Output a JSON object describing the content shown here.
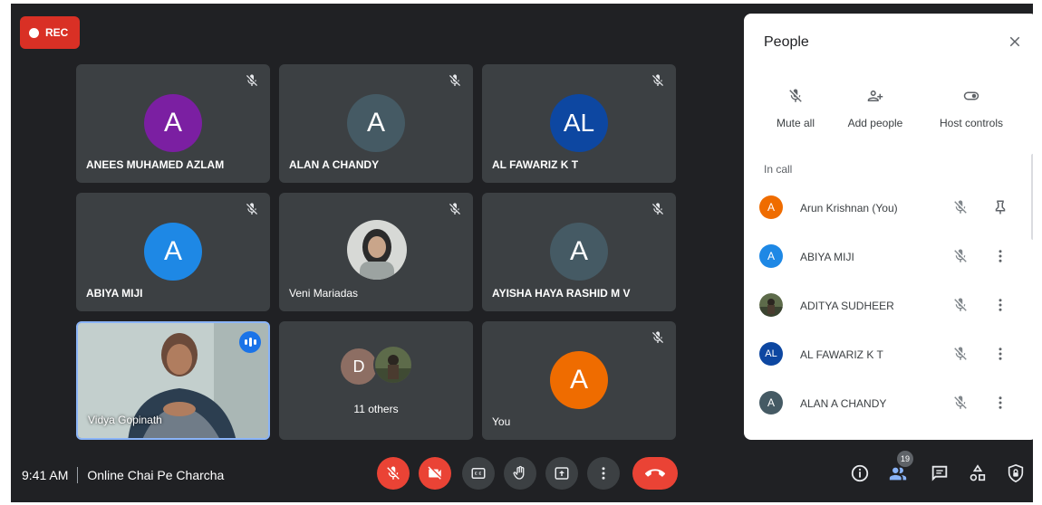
{
  "recording": {
    "label": "REC"
  },
  "tiles": [
    {
      "name": "ANEES MUHAMED AZLAM",
      "initial": "A",
      "color": "#7b1fa2"
    },
    {
      "name": "ALAN A CHANDY",
      "initial": "A",
      "color": "#455a64"
    },
    {
      "name": "AL FAWARIZ K T",
      "initial": "AL",
      "color": "#0d47a1"
    },
    {
      "name": "ABIYA MIJI",
      "initial": "A",
      "color": "#1e88e5"
    },
    {
      "name": "Veni Mariadas",
      "initial": ""
    },
    {
      "name": "AYISHA HAYA RASHID M V",
      "initial": "A",
      "color": "#455a64"
    },
    {
      "name": "Vidya Gopinath"
    },
    {
      "name": "11 others",
      "initial": "D",
      "color": "#8d6e63"
    },
    {
      "name": "You",
      "initial": "A",
      "color": "#ef6c00"
    }
  ],
  "panel": {
    "title": "People",
    "actions": {
      "mute_all": "Mute all",
      "add_people": "Add people",
      "host_controls": "Host controls"
    },
    "section": "In call",
    "participants": [
      {
        "name": "Arun Krishnan (You)",
        "initial": "A",
        "color": "#ef6c00"
      },
      {
        "name": "ABIYA MIJI",
        "initial": "A",
        "color": "#1e88e5"
      },
      {
        "name": "ADITYA SUDHEER",
        "initial": "",
        "color": "#4e5b3c"
      },
      {
        "name": "AL FAWARIZ K T",
        "initial": "AL",
        "color": "#0d47a1"
      },
      {
        "name": "ALAN A CHANDY",
        "initial": "A",
        "color": "#455a64"
      }
    ]
  },
  "bottom": {
    "time": "9:41 AM",
    "meeting": "Online Chai Pe Charcha",
    "people_count": "19"
  }
}
